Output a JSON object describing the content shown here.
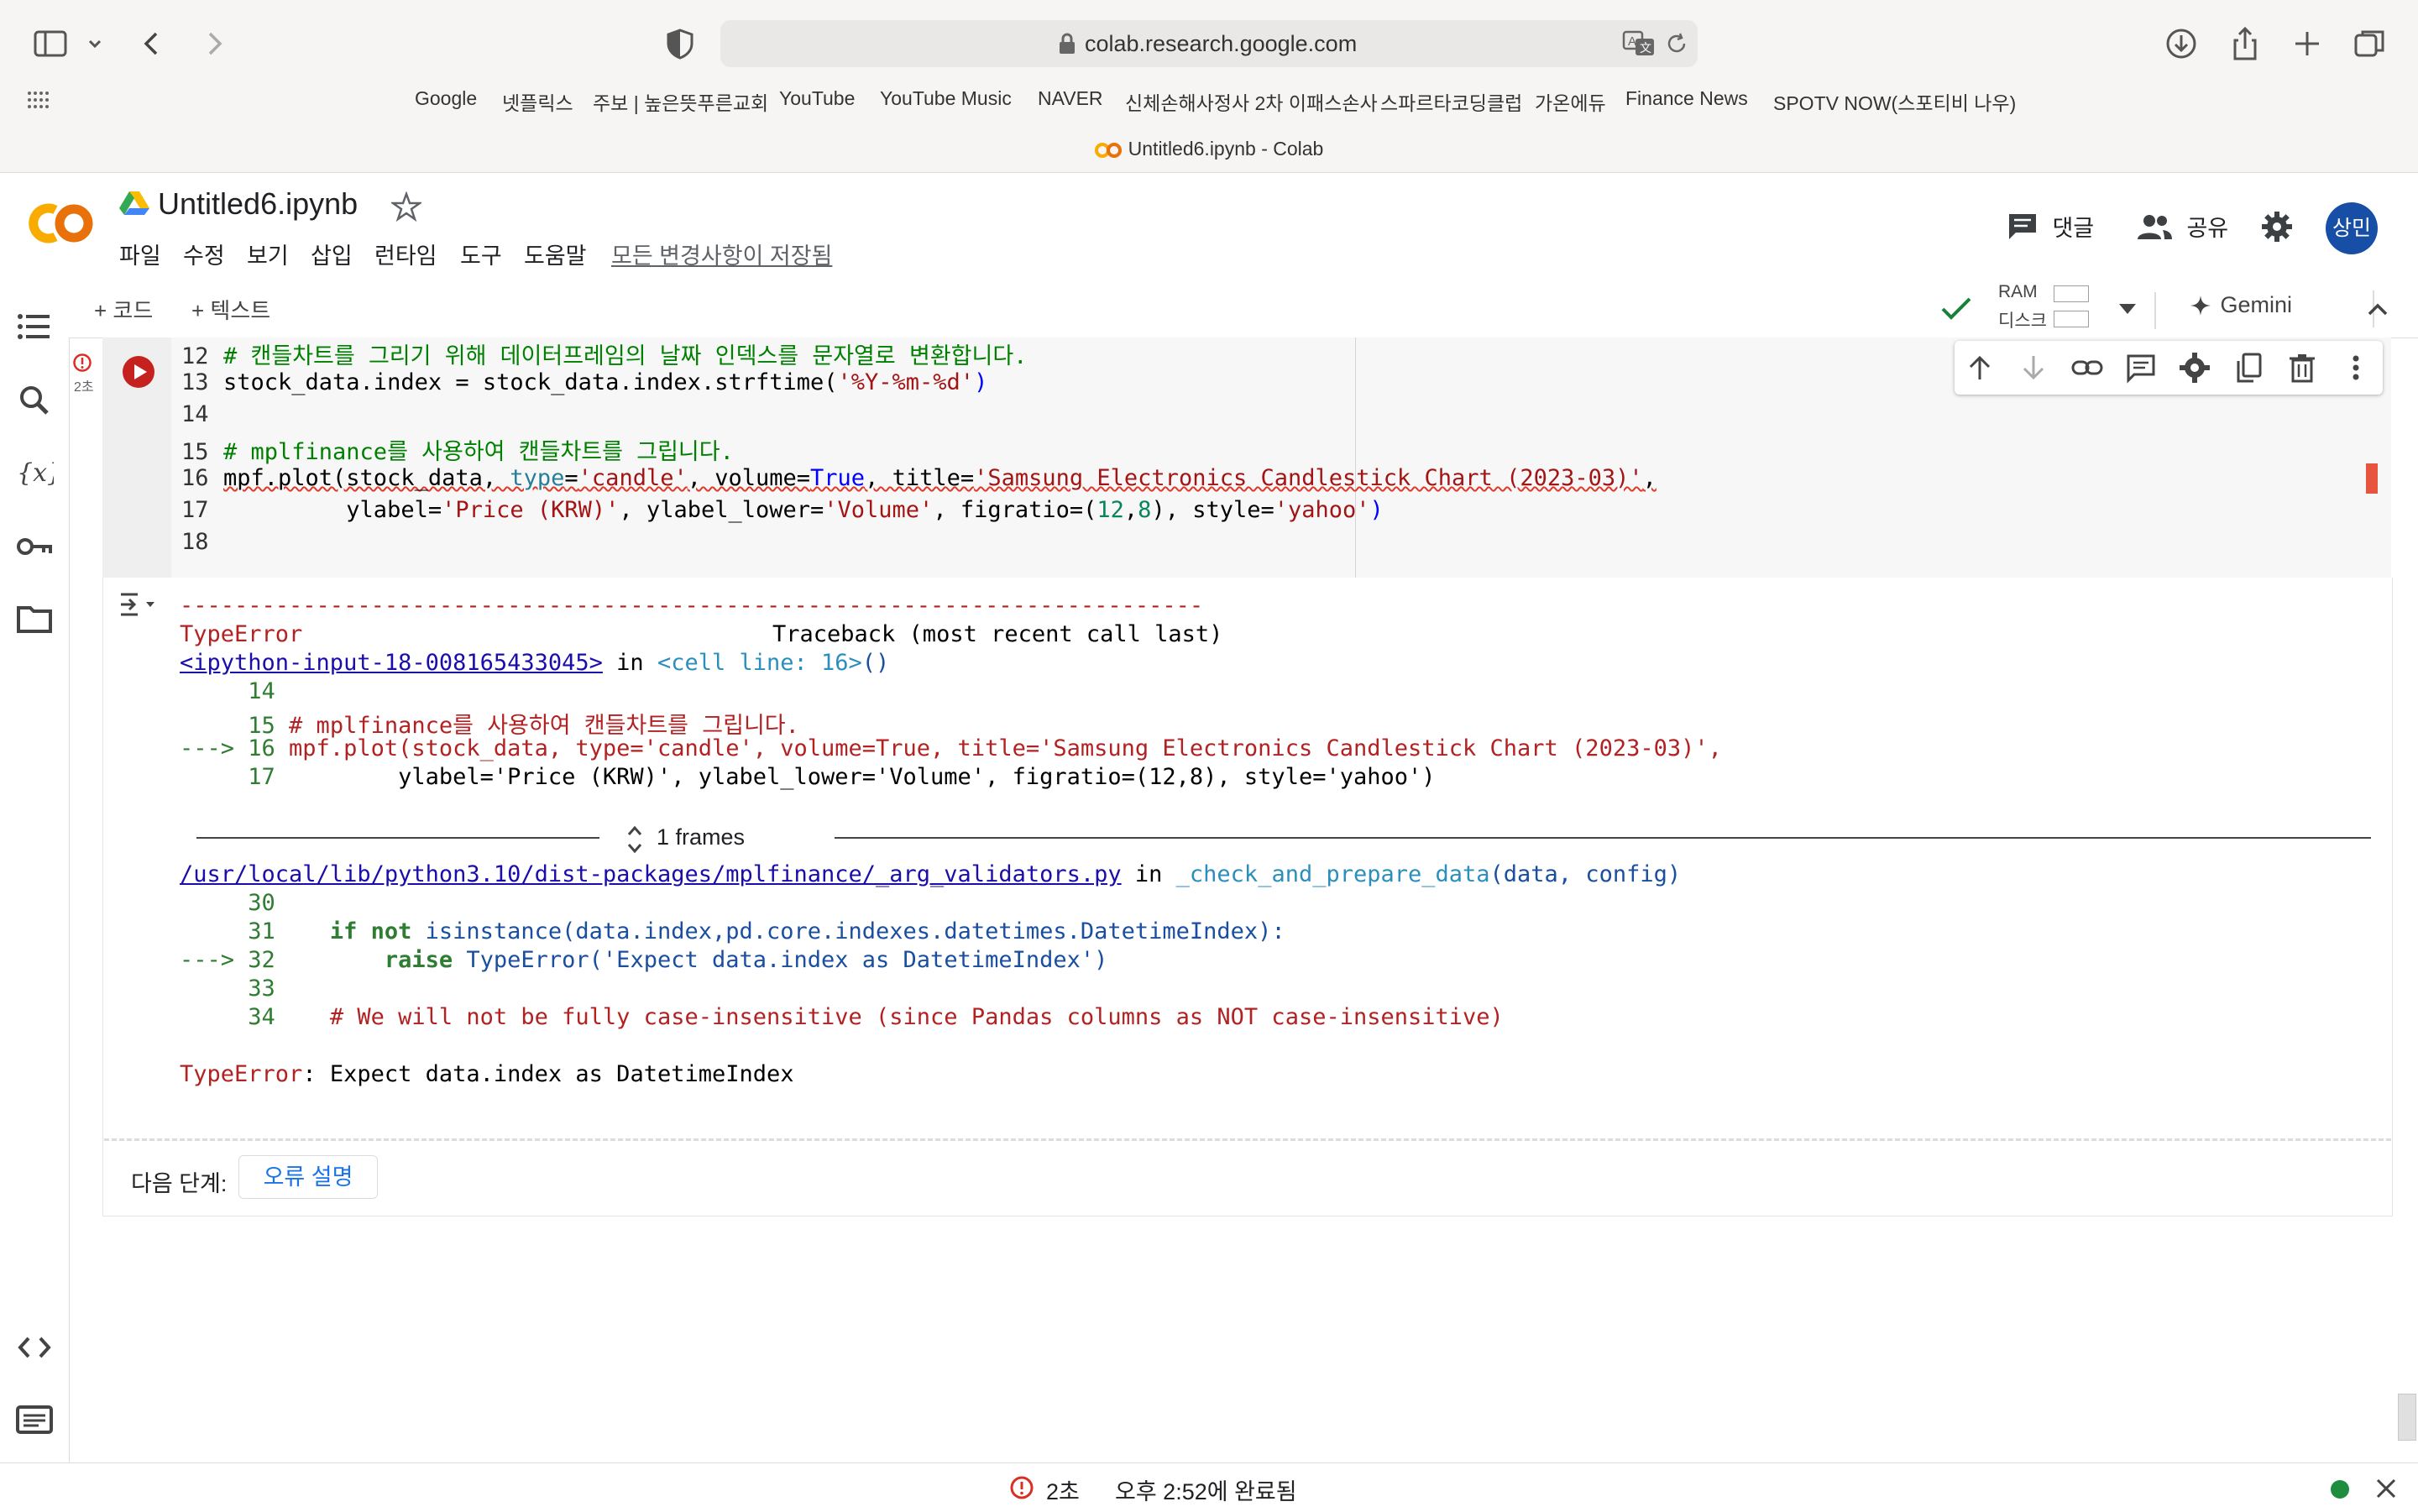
{
  "browser": {
    "url": "colab.research.google.com",
    "tab_title": "Untitled6.ipynb - Colab",
    "bookmarks": [
      "Google",
      "넷플릭스",
      "주보 | 높은뜻푸른교회",
      "YouTube",
      "YouTube Music",
      "NAVER",
      "신체손해사정사 2차 이패스손사",
      "스파르타코딩클럽",
      "가온에듀",
      "Finance News",
      "SPOTV NOW(스포티비 나우)"
    ]
  },
  "colab": {
    "notebook_title": "Untitled6.ipynb",
    "menu": [
      "파일",
      "수정",
      "보기",
      "삽입",
      "런타임",
      "도구",
      "도움말"
    ],
    "save_status": "모든 변경사항이 저장됨",
    "comment_label": "댓글",
    "share_label": "공유",
    "avatar_initials": "상민",
    "add_code": "+ 코드",
    "add_text": "+ 텍스트",
    "ram_label": "RAM",
    "disk_label": "디스크",
    "gemini_label": "Gemini",
    "exec_time": "2초",
    "accent_color": "#f9ab00"
  },
  "code": {
    "line_numbers": [
      "12",
      "13",
      "14",
      "15",
      "16",
      "17",
      "18"
    ],
    "l12": "# 캔들차트를 그리기 위해 데이터프레임의 날짜 인덱스를 문자열로 변환합니다.",
    "l13_a": "stock_data.index = stock_data.index.strftime(",
    "l13_b": "'%Y-%m-%d'",
    "l13_c": ")",
    "l15": "# mplfinance를 사용하여 캔들차트를 그립니다.",
    "l16_a": "mpf.plot(stock_data, ",
    "l16_b": "type",
    "l16_c": "=",
    "l16_d": "'candle'",
    "l16_e": ", volume=",
    "l16_f": "True",
    "l16_g": ", title=",
    "l16_h": "'Samsung Electronics Candlestick Chart (2023-03)'",
    "l16_i": ",",
    "l17_a": "         ylabel=",
    "l17_b": "'Price (KRW)'",
    "l17_c": ", ylabel_lower=",
    "l17_d": "'Volume'",
    "l17_e": ", figratio=(",
    "l17_f": "12",
    "l17_g": ",",
    "l17_h": "8",
    "l17_i": "), style=",
    "l17_j": "'yahoo'",
    "l17_k": ")"
  },
  "output": {
    "rule": "---------------------------------------------------------------------------",
    "error_type": "TypeError",
    "traceback_header": "Traceback (most recent call last)",
    "input_link": "<ipython-input-18-008165433045>",
    "in_word": " in ",
    "cell_line": "<cell line: 16>",
    "cell_parens": "()",
    "t14": "     14",
    "t15_num": "     15 ",
    "t15": "# mplfinance를 사용하여 캔들차트를 그립니다.",
    "t16_arrow": "---> 16 ",
    "t16": "mpf.plot(stock_data, type='candle', volume=True, title='Samsung Electronics Candlestick Chart (2023-03)',",
    "t17_num": "     17 ",
    "t17": "        ylabel='Price (KRW)', ylabel_lower='Volume', figratio=(12,8), style='yahoo')",
    "frames_label": "1 frames",
    "lib_link": "/usr/local/lib/python3.10/dist-packages/mplfinance/_arg_validators.py",
    "func_name": "_check_and_prepare_data",
    "func_args": "(data, config)",
    "t30": "     30",
    "t31_num": "     31 ",
    "t31_if": "   if not ",
    "t31_rest": "isinstance(data.index,pd.core.indexes.datetimes.DatetimeIndex):",
    "t32_arrow": "---> 32 ",
    "t32_raise": "       raise ",
    "t32_rest": "TypeError('Expect data.index as DatetimeIndex')",
    "t33": "     33",
    "t34_num": "     34 ",
    "t34": "   # We will not be fully case-insensitive (since Pandas columns as NOT case-insensitive)",
    "final_type": "TypeError",
    "final_msg": ": Expect data.index as DatetimeIndex"
  },
  "next_steps": {
    "label": "다음 단계:",
    "explain_button": "오류 설명"
  },
  "status": {
    "time": "2초",
    "completed": "오후 2:52에 완료됨"
  }
}
